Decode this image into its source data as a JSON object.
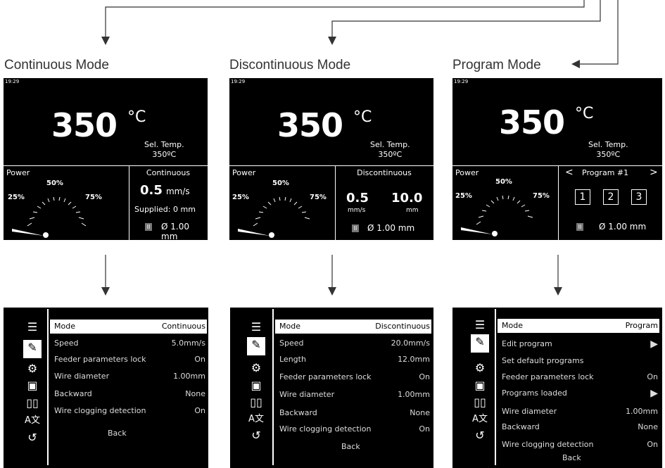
{
  "modes": [
    {
      "title": "Continuous Mode",
      "clock": "19:29",
      "temp": "350",
      "deg": "°C",
      "sel_label": "Sel. Temp.",
      "sel_value": "350ºC",
      "power_label": "Power",
      "p25": "25%",
      "p50": "50%",
      "p75": "75%",
      "panel_title": "Continuous",
      "speed_value": "0.5",
      "speed_unit": "mm/s",
      "supplied": "Supplied: 0 mm",
      "pause": "II",
      "diameter": "Ø 1.00 mm"
    },
    {
      "title": "Discontinuous Mode",
      "clock": "19:29",
      "temp": "350",
      "deg": "°C",
      "sel_label": "Sel. Temp.",
      "sel_value": "350ºC",
      "power_label": "Power",
      "p25": "25%",
      "p50": "50%",
      "p75": "75%",
      "panel_title": "Discontinuous",
      "speed_value": "0.5",
      "speed_unit": "mm/s",
      "length_value": "10.0",
      "length_unit": "mm",
      "pause": "II",
      "diameter": "Ø 1.00 mm"
    },
    {
      "title": "Program Mode",
      "clock": "19:29",
      "temp": "350",
      "deg": "°C",
      "sel_label": "Sel. Temp.",
      "sel_value": "350ºC",
      "power_label": "Power",
      "p25": "25%",
      "p50": "50%",
      "p75": "75%",
      "program_prev": "<",
      "program_title": "Program #1",
      "program_next": ">",
      "programs": [
        "1",
        "2",
        "3"
      ],
      "pause": "II",
      "diameter": "Ø 1.00 mm"
    }
  ],
  "menus": [
    {
      "rows": [
        {
          "label": "Mode",
          "value": "Continuous"
        },
        {
          "label": "Speed",
          "value": "5.0mm/s"
        },
        {
          "label": "Feeder parameters lock",
          "value": "On"
        },
        {
          "label": "Wire diameter",
          "value": "1.00mm"
        },
        {
          "label": "Backward",
          "value": "None"
        },
        {
          "label": "Wire clogging detection",
          "value": "On"
        }
      ],
      "back": "Back"
    },
    {
      "rows": [
        {
          "label": "Mode",
          "value": "Discontinuous"
        },
        {
          "label": "Speed",
          "value": "20.0mm/s"
        },
        {
          "label": "Length",
          "value": "12.0mm"
        },
        {
          "label": "Feeder parameters lock",
          "value": "On"
        },
        {
          "label": "Wire diameter",
          "value": "1.00mm"
        },
        {
          "label": "Backward",
          "value": "None"
        },
        {
          "label": "Wire clogging detection",
          "value": "On"
        }
      ],
      "back": "Back"
    },
    {
      "rows": [
        {
          "label": "Mode",
          "value": "Program"
        },
        {
          "label": "Edit program",
          "value": "▶"
        },
        {
          "label": "Set default programs",
          "value": ""
        },
        {
          "label": "Feeder parameters lock",
          "value": "On"
        },
        {
          "label": "Programs loaded",
          "value": "▶"
        },
        {
          "label": "Wire diameter",
          "value": "1.00mm"
        },
        {
          "label": "Backward",
          "value": "None"
        },
        {
          "label": "Wire clogging detection",
          "value": "On"
        }
      ],
      "back": "Back"
    }
  ],
  "menu_icons": [
    "menu-list-icon",
    "soldering-iron-icon",
    "temperature-settings-icon",
    "station-settings-icon",
    "counters-icon",
    "language-icon",
    "back-icon"
  ],
  "colors": {
    "screen_bg": "#000000",
    "text": "#ffffff",
    "arrow": "#333333",
    "pause_bg": "#777777"
  }
}
